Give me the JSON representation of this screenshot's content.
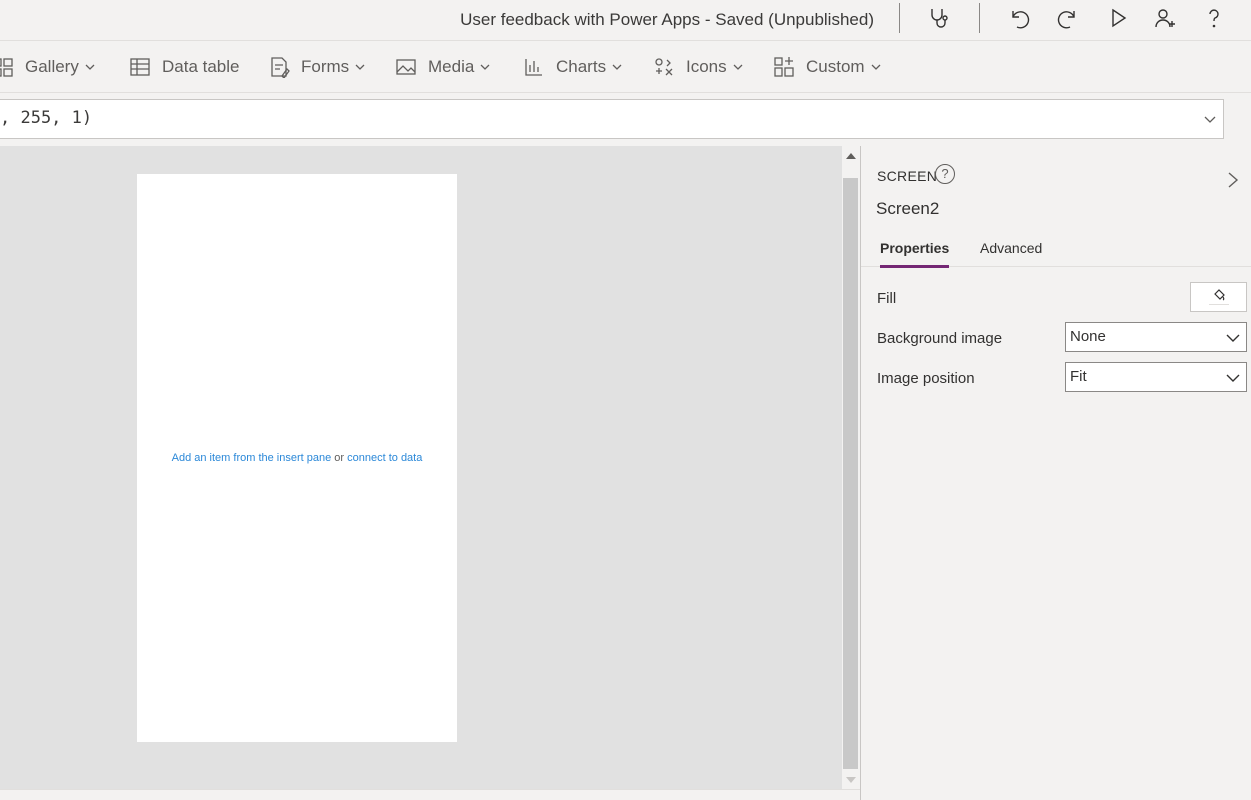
{
  "titlebar": {
    "app_title": "User feedback with Power Apps - Saved (Unpublished)",
    "icons": [
      "stethoscope-icon",
      "undo-icon",
      "redo-icon",
      "play-icon",
      "add-person-icon",
      "help-icon"
    ]
  },
  "ribbon": {
    "items": [
      {
        "label": "Gallery",
        "icon": "gallery-icon"
      },
      {
        "label": "Data table",
        "icon": "data-table-icon"
      },
      {
        "label": "Forms",
        "icon": "forms-icon"
      },
      {
        "label": "Media",
        "icon": "media-icon"
      },
      {
        "label": "Charts",
        "icon": "charts-icon"
      },
      {
        "label": "Icons",
        "icon": "icons-icon"
      },
      {
        "label": "Custom",
        "icon": "custom-icon"
      }
    ]
  },
  "formula": {
    "value": ", 255, 1)"
  },
  "canvas": {
    "hint_link_insert": "Add an item from the insert pane",
    "hint_or": "or",
    "hint_link_data": "connect to data"
  },
  "pane": {
    "kind": "SCREEN",
    "help": "?",
    "name": "Screen2",
    "tabs": [
      {
        "label": "Properties",
        "active": true
      },
      {
        "label": "Advanced",
        "active": false
      }
    ],
    "fill_label": "Fill",
    "fill_color": "#ffffff",
    "background_image_label": "Background image",
    "background_image_value": "None",
    "image_position_label": "Image position",
    "image_position_value": "Fit"
  },
  "colors": {
    "accent": "#742774",
    "link": "#2b88d8",
    "canvas_bg": "#e1e1e1"
  }
}
